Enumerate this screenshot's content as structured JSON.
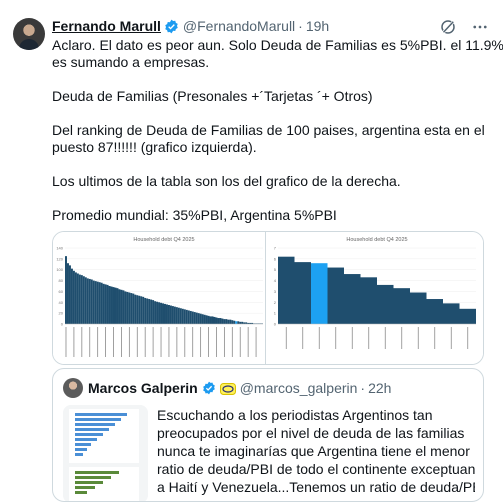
{
  "tweet": {
    "author_name": "Fernando Marull",
    "handle": "@FernandoMarull",
    "separator": "·",
    "time": "19h",
    "icons": [
      "grok-icon",
      "more-icon"
    ],
    "verified_color": "#1d9bf0",
    "lines": [
      [
        "Aclaro. El dato es peor aun. Solo Deuda de Familias es 5%PBI. el 11.9%PBI",
        "es sumando a empresas."
      ],
      [
        "Deuda de Familias (Presonales +´Tarjetas ´+ Otros)"
      ],
      [
        "Del ranking de Deuda de Familias de 100 paises, argentina esta en el",
        "puesto 87!!!!!! (grafico izquierda)."
      ],
      [
        "Los ultimos de la tabla son los del grafico de la derecha."
      ],
      [
        "Promedio mundial: 35%PBI, Argentina 5%PBI"
      ]
    ]
  },
  "chart_data": [
    {
      "type": "bar",
      "title": "Household debt Q4 2025",
      "ylim": [
        0,
        140
      ],
      "yticks": [
        0,
        20,
        40,
        60,
        80,
        100,
        120,
        140
      ],
      "color": "#1f4e6e",
      "highlight_color": "#1da1f2",
      "highlight_index": 86,
      "values": [
        125,
        112,
        108,
        102,
        98,
        95,
        93,
        91,
        90,
        88,
        86,
        84,
        83,
        82,
        80,
        79,
        78,
        77,
        76,
        74,
        73,
        72,
        70,
        69,
        68,
        67,
        66,
        64,
        63,
        62,
        60,
        59,
        58,
        57,
        56,
        54,
        53,
        52,
        51,
        50,
        48,
        47,
        46,
        45,
        44,
        42,
        41,
        40,
        39,
        38,
        37,
        36,
        35,
        34,
        33,
        32,
        31,
        30,
        29,
        28,
        27,
        26,
        25,
        24,
        23,
        22,
        21,
        20,
        19,
        18,
        17,
        16,
        15,
        14,
        14,
        13,
        12,
        11,
        11,
        10,
        9,
        9,
        8,
        8,
        7,
        6,
        5,
        5,
        4,
        4,
        3,
        3,
        2,
        2,
        2,
        1,
        1,
        1,
        1,
        1
      ]
    },
    {
      "type": "bar",
      "title": "Household debt Q4 2025",
      "ylim": [
        0,
        7
      ],
      "yticks": [
        0,
        1,
        2,
        3,
        4,
        5,
        6,
        7
      ],
      "color": "#1f4e6e",
      "highlight_color": "#1da1f2",
      "highlight_index": 2,
      "values": [
        6.2,
        5.7,
        5.6,
        5.2,
        4.6,
        4.3,
        3.6,
        3.3,
        2.9,
        2.3,
        1.9,
        1.4
      ]
    }
  ],
  "quote": {
    "author_name": "Marcos Galperin",
    "handle": "@marcos_galperin",
    "separator": "·",
    "time": "22h",
    "verified_color": "#1d9bf0",
    "lines": [
      "Escuchando a los periodistas Argentinos tan",
      "preocupados por el nivel de deuda de las familias",
      "nunca te imaginarías que Argentina tiene el menor",
      "ratio de deuda/PBI de todo el continente exceptuando",
      "a Haití y Venezuela...Tenemos un ratio de deuda/PBI ..."
    ]
  }
}
